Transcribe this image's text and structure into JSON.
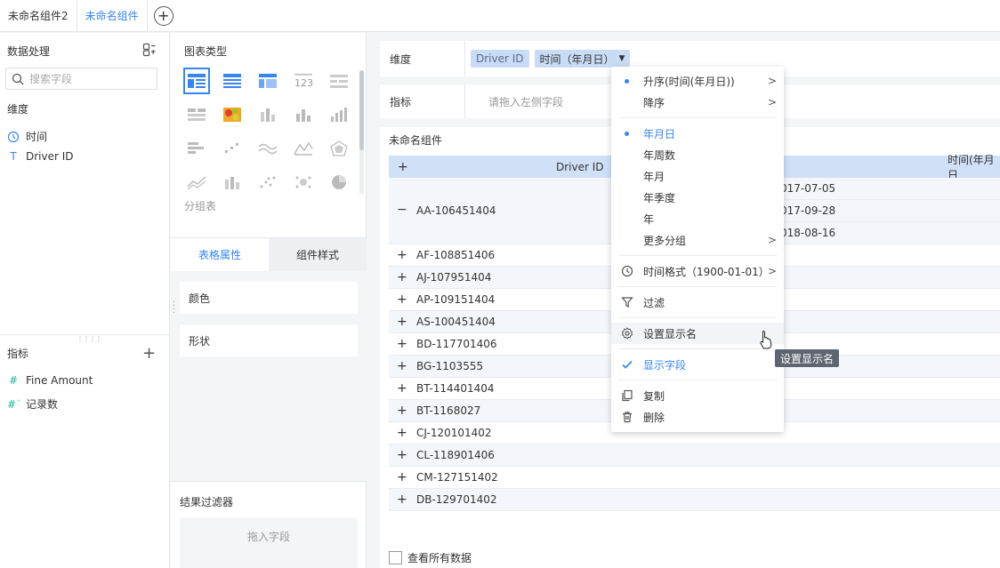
{
  "tabs": [
    "未命名组件2",
    "未命名组件"
  ],
  "left_panel": {
    "title": "数据处理",
    "search_placeholder": "搜索字段",
    "dimension_section": "维度",
    "dimensions": [
      {
        "icon": "clock-icon",
        "label": "时间"
      },
      {
        "icon": "text-icon",
        "label": "Driver ID"
      }
    ],
    "metric_section": "指标",
    "metrics": [
      {
        "icon": "number-icon",
        "label": "Fine Amount"
      },
      {
        "icon": "record-count-icon",
        "label": "记录数"
      }
    ]
  },
  "mid_panel": {
    "chart_type_title": "图表类型",
    "chart_type_label": "分组表",
    "props_tabs": [
      "表格属性",
      "组件样式"
    ],
    "props": [
      "颜色",
      "形状"
    ],
    "filter_title": "结果过滤器",
    "filter_placeholder": "拖入字段"
  },
  "work": {
    "dimension_label": "维度",
    "dimension_pills": [
      "Driver ID",
      "时间（年月日）"
    ],
    "metric_label": "指标",
    "metric_placeholder": "请拖入左侧字段",
    "component_title": "未命名组件",
    "table": {
      "headers": [
        "Driver ID",
        "时间(年月日"
      ],
      "group": {
        "id": "AA-106451404",
        "dates": [
          "017-07-05",
          "017-09-28",
          "018-08-16"
        ]
      },
      "rows": [
        "AF-108851406",
        "AJ-107951404",
        "AP-109151404",
        "AS-100451404",
        "BD-117701406",
        "BG-1103555",
        "BT-114401404",
        "BT-1168027",
        "CJ-120101402",
        "CL-118901406",
        "CM-127151402",
        "DB-129701402"
      ]
    },
    "see_all": "查看所有数据"
  },
  "menu": {
    "sort": [
      {
        "label": "升序(时间(年月日))",
        "selected": true
      },
      {
        "label": "降序",
        "selected": false
      }
    ],
    "granularity": [
      {
        "label": "年月日",
        "selected": true
      },
      {
        "label": "年周数",
        "selected": false
      },
      {
        "label": "年月",
        "selected": false
      },
      {
        "label": "年季度",
        "selected": false
      },
      {
        "label": "年",
        "selected": false
      },
      {
        "label": "更多分组",
        "selected": false
      }
    ],
    "time_format": "时间格式（1900-01-01）",
    "filter": "过滤",
    "set_display_name": "设置显示名",
    "show_field": "显示字段",
    "copy": "复制",
    "delete": "删除"
  },
  "tooltip": "设置显示名",
  "colors": {
    "accent": "#3685f2",
    "pill": "#c9dcf6",
    "header": "#cfe0f7",
    "metric_icon": "#1bb99a"
  }
}
